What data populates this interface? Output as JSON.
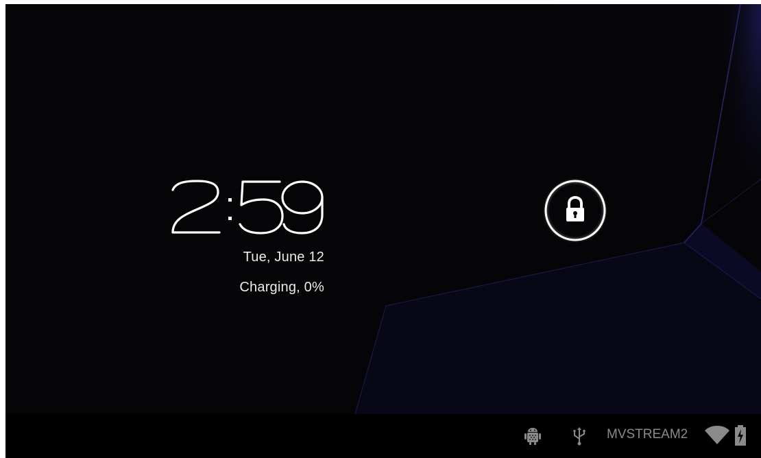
{
  "lockscreen": {
    "clock": {
      "hours": "2",
      "minutes": "59"
    },
    "date": "Tue, June 12",
    "charging_status": "Charging, 0%",
    "unlock_icon": "lock-icon"
  },
  "system_bar": {
    "network_name": "MVSTREAM2",
    "icons": [
      "android-debug-icon",
      "usb-icon",
      "wifi-icon",
      "battery-charging-icon"
    ]
  },
  "colors": {
    "background": "#050507",
    "wallpaper_accent": "#3a3a9a",
    "text": "#ececec",
    "status_text": "#8a8a8a",
    "system_bar": "#000000"
  }
}
